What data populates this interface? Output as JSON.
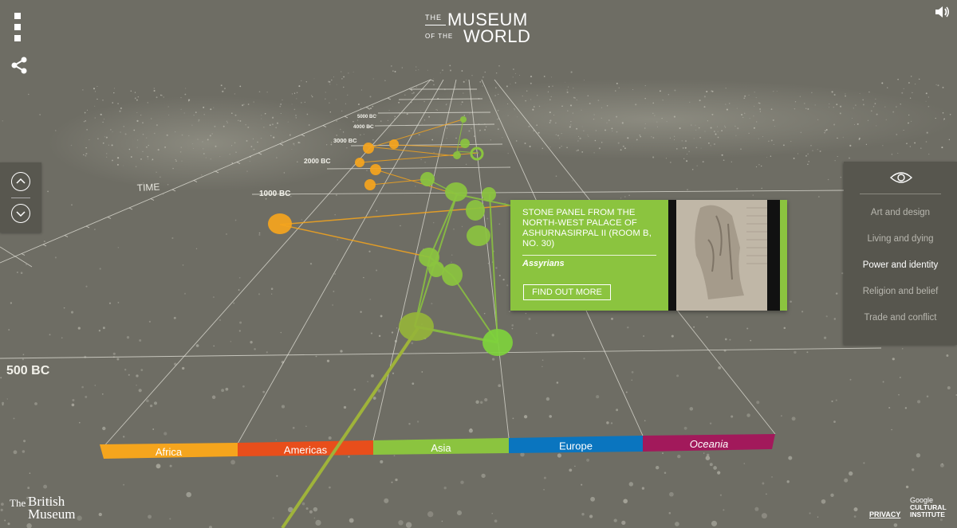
{
  "header": {
    "logo": {
      "the": "THE",
      "museum": "MUSEUM",
      "of_the": "OF THE",
      "world": "WORLD"
    }
  },
  "toolbar": {
    "menu_icon": "menu-dots-icon",
    "share_icon": "share-icon",
    "sound_icon": "speaker-icon"
  },
  "timeline": {
    "axis_label": "TIME",
    "ticks": [
      "5000 BC",
      "4000 BC",
      "3000 BC",
      "2000 BC",
      "1000 BC",
      "500 BC"
    ],
    "regions": [
      {
        "label": "Africa",
        "color": "#f5a51d"
      },
      {
        "label": "Americas",
        "color": "#e84e1b"
      },
      {
        "label": "Asia",
        "color": "#8bc43f"
      },
      {
        "label": "Europe",
        "color": "#0a75bf"
      },
      {
        "label": "Oceania",
        "color": "#a2195b"
      }
    ]
  },
  "filters": {
    "eye_icon": "eye-icon",
    "items": [
      "Art and design",
      "Living and dying",
      "Power and identity",
      "Religion and belief",
      "Trade and conflict"
    ],
    "active_index": 2
  },
  "popup": {
    "title": "STONE PANEL FROM THE NORTH-WEST PALACE OF ASHURNASIRPAL II (ROOM B, NO. 30)",
    "culture": "Assyrians",
    "button": "FIND OUT MORE"
  },
  "footer": {
    "bm_the": "The",
    "bm_british": "British",
    "bm_museum": "Museum",
    "privacy": "PRIVACY",
    "google": "Google",
    "cultural": "CULTURAL",
    "institute": "INSTITUTE"
  },
  "colors": {
    "background": "#6e6d64",
    "africa_nodes": "#f5a51d",
    "asia_nodes": "#8bc43f"
  }
}
